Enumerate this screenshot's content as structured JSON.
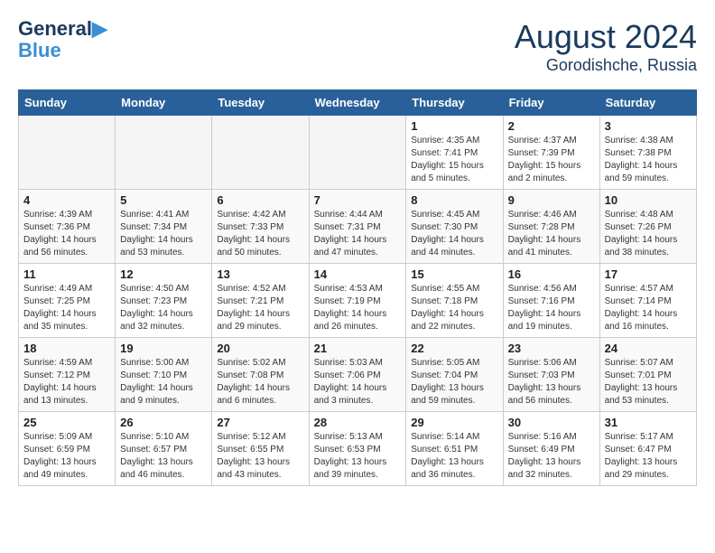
{
  "header": {
    "logo_line1": "General",
    "logo_line2": "Blue",
    "month": "August 2024",
    "location": "Gorodishche, Russia"
  },
  "weekdays": [
    "Sunday",
    "Monday",
    "Tuesday",
    "Wednesday",
    "Thursday",
    "Friday",
    "Saturday"
  ],
  "weeks": [
    [
      {
        "day": "",
        "info": ""
      },
      {
        "day": "",
        "info": ""
      },
      {
        "day": "",
        "info": ""
      },
      {
        "day": "",
        "info": ""
      },
      {
        "day": "1",
        "info": "Sunrise: 4:35 AM\nSunset: 7:41 PM\nDaylight: 15 hours\nand 5 minutes."
      },
      {
        "day": "2",
        "info": "Sunrise: 4:37 AM\nSunset: 7:39 PM\nDaylight: 15 hours\nand 2 minutes."
      },
      {
        "day": "3",
        "info": "Sunrise: 4:38 AM\nSunset: 7:38 PM\nDaylight: 14 hours\nand 59 minutes."
      }
    ],
    [
      {
        "day": "4",
        "info": "Sunrise: 4:39 AM\nSunset: 7:36 PM\nDaylight: 14 hours\nand 56 minutes."
      },
      {
        "day": "5",
        "info": "Sunrise: 4:41 AM\nSunset: 7:34 PM\nDaylight: 14 hours\nand 53 minutes."
      },
      {
        "day": "6",
        "info": "Sunrise: 4:42 AM\nSunset: 7:33 PM\nDaylight: 14 hours\nand 50 minutes."
      },
      {
        "day": "7",
        "info": "Sunrise: 4:44 AM\nSunset: 7:31 PM\nDaylight: 14 hours\nand 47 minutes."
      },
      {
        "day": "8",
        "info": "Sunrise: 4:45 AM\nSunset: 7:30 PM\nDaylight: 14 hours\nand 44 minutes."
      },
      {
        "day": "9",
        "info": "Sunrise: 4:46 AM\nSunset: 7:28 PM\nDaylight: 14 hours\nand 41 minutes."
      },
      {
        "day": "10",
        "info": "Sunrise: 4:48 AM\nSunset: 7:26 PM\nDaylight: 14 hours\nand 38 minutes."
      }
    ],
    [
      {
        "day": "11",
        "info": "Sunrise: 4:49 AM\nSunset: 7:25 PM\nDaylight: 14 hours\nand 35 minutes."
      },
      {
        "day": "12",
        "info": "Sunrise: 4:50 AM\nSunset: 7:23 PM\nDaylight: 14 hours\nand 32 minutes."
      },
      {
        "day": "13",
        "info": "Sunrise: 4:52 AM\nSunset: 7:21 PM\nDaylight: 14 hours\nand 29 minutes."
      },
      {
        "day": "14",
        "info": "Sunrise: 4:53 AM\nSunset: 7:19 PM\nDaylight: 14 hours\nand 26 minutes."
      },
      {
        "day": "15",
        "info": "Sunrise: 4:55 AM\nSunset: 7:18 PM\nDaylight: 14 hours\nand 22 minutes."
      },
      {
        "day": "16",
        "info": "Sunrise: 4:56 AM\nSunset: 7:16 PM\nDaylight: 14 hours\nand 19 minutes."
      },
      {
        "day": "17",
        "info": "Sunrise: 4:57 AM\nSunset: 7:14 PM\nDaylight: 14 hours\nand 16 minutes."
      }
    ],
    [
      {
        "day": "18",
        "info": "Sunrise: 4:59 AM\nSunset: 7:12 PM\nDaylight: 14 hours\nand 13 minutes."
      },
      {
        "day": "19",
        "info": "Sunrise: 5:00 AM\nSunset: 7:10 PM\nDaylight: 14 hours\nand 9 minutes."
      },
      {
        "day": "20",
        "info": "Sunrise: 5:02 AM\nSunset: 7:08 PM\nDaylight: 14 hours\nand 6 minutes."
      },
      {
        "day": "21",
        "info": "Sunrise: 5:03 AM\nSunset: 7:06 PM\nDaylight: 14 hours\nand 3 minutes."
      },
      {
        "day": "22",
        "info": "Sunrise: 5:05 AM\nSunset: 7:04 PM\nDaylight: 13 hours\nand 59 minutes."
      },
      {
        "day": "23",
        "info": "Sunrise: 5:06 AM\nSunset: 7:03 PM\nDaylight: 13 hours\nand 56 minutes."
      },
      {
        "day": "24",
        "info": "Sunrise: 5:07 AM\nSunset: 7:01 PM\nDaylight: 13 hours\nand 53 minutes."
      }
    ],
    [
      {
        "day": "25",
        "info": "Sunrise: 5:09 AM\nSunset: 6:59 PM\nDaylight: 13 hours\nand 49 minutes."
      },
      {
        "day": "26",
        "info": "Sunrise: 5:10 AM\nSunset: 6:57 PM\nDaylight: 13 hours\nand 46 minutes."
      },
      {
        "day": "27",
        "info": "Sunrise: 5:12 AM\nSunset: 6:55 PM\nDaylight: 13 hours\nand 43 minutes."
      },
      {
        "day": "28",
        "info": "Sunrise: 5:13 AM\nSunset: 6:53 PM\nDaylight: 13 hours\nand 39 minutes."
      },
      {
        "day": "29",
        "info": "Sunrise: 5:14 AM\nSunset: 6:51 PM\nDaylight: 13 hours\nand 36 minutes."
      },
      {
        "day": "30",
        "info": "Sunrise: 5:16 AM\nSunset: 6:49 PM\nDaylight: 13 hours\nand 32 minutes."
      },
      {
        "day": "31",
        "info": "Sunrise: 5:17 AM\nSunset: 6:47 PM\nDaylight: 13 hours\nand 29 minutes."
      }
    ]
  ]
}
